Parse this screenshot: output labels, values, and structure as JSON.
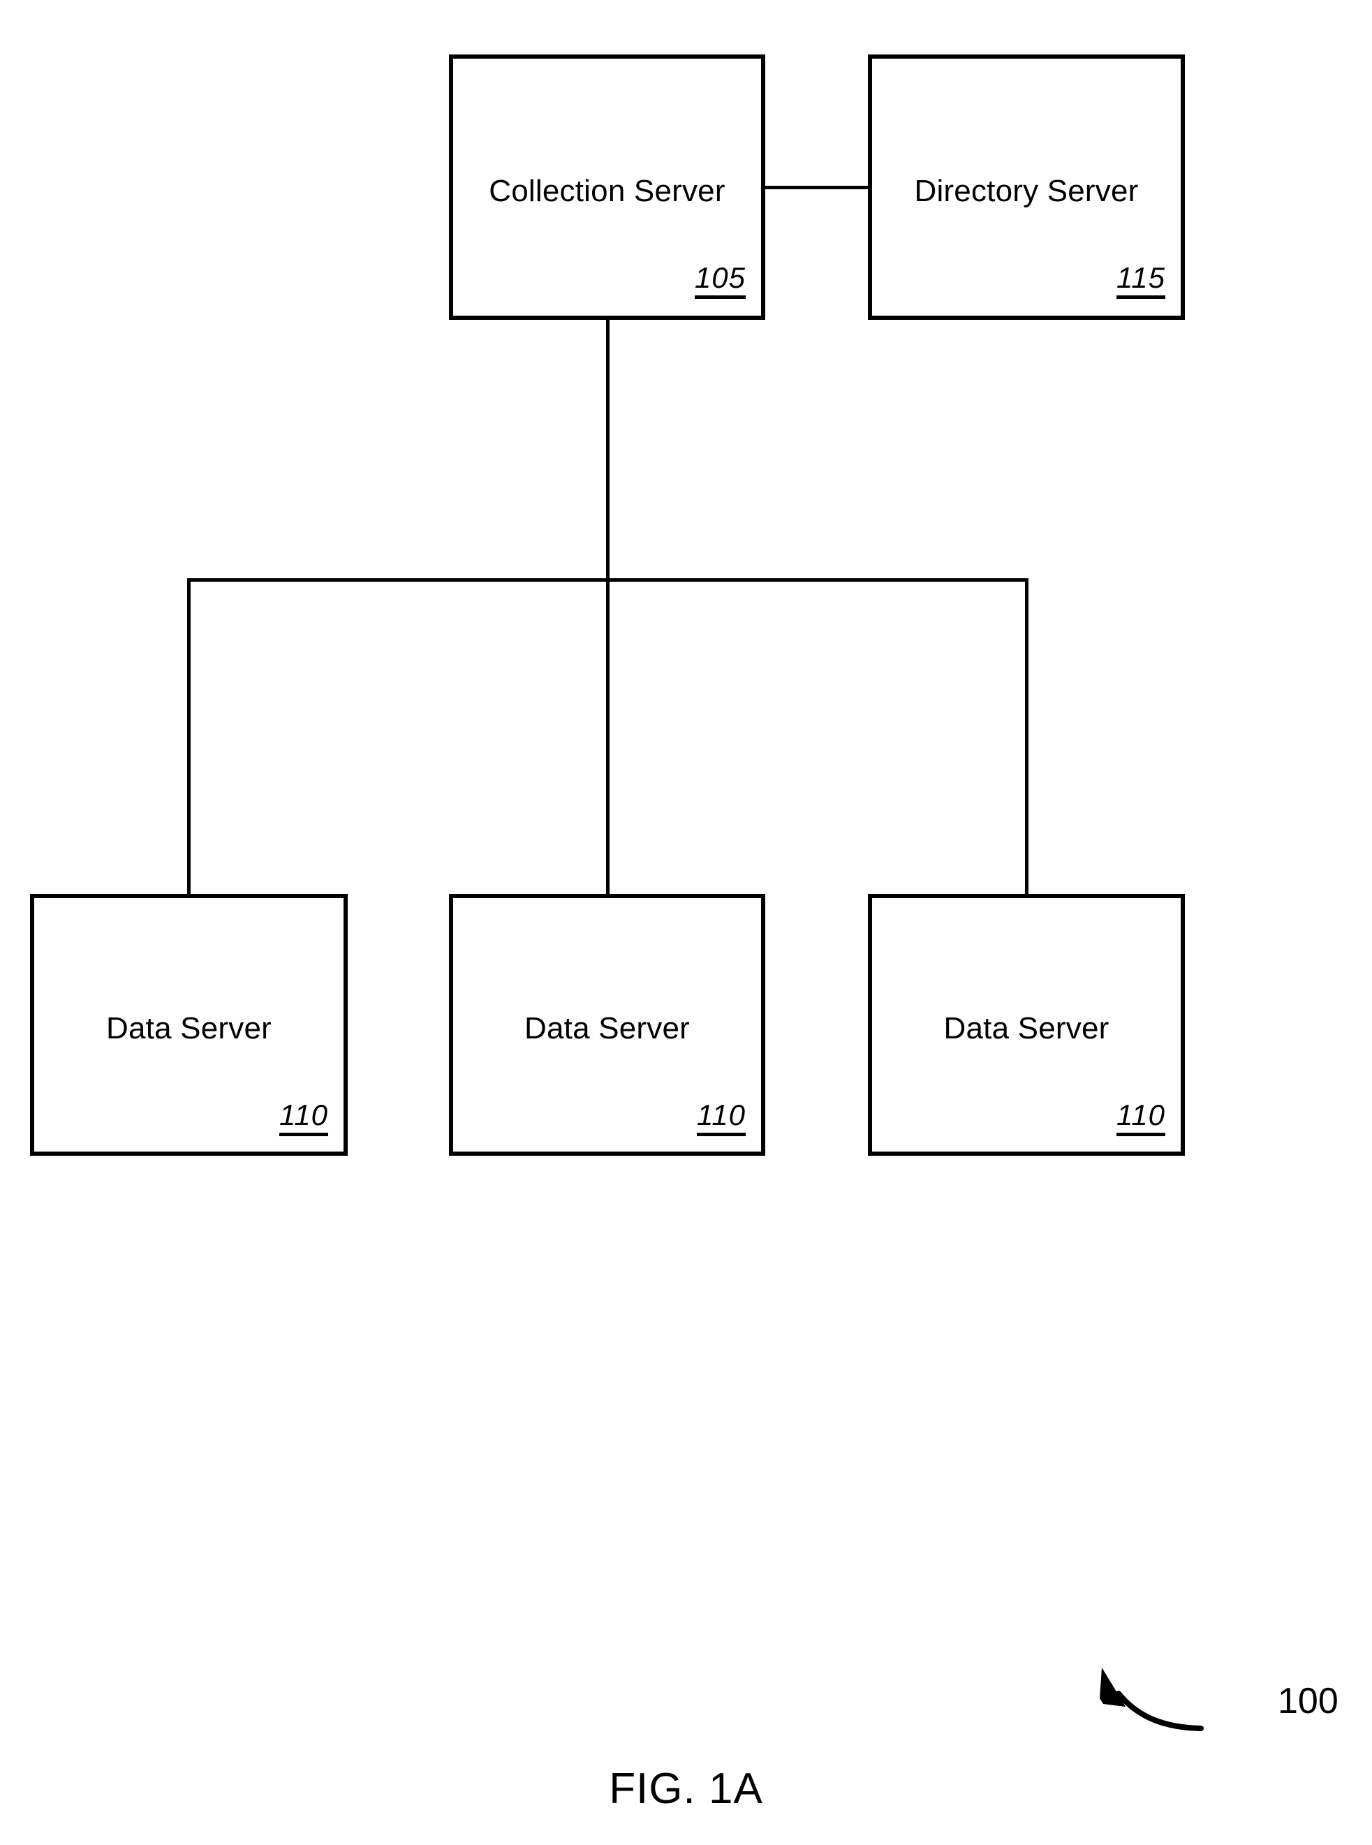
{
  "figure": {
    "caption": "FIG. 1A",
    "system_reference": "100"
  },
  "nodes": {
    "collection_server": {
      "label": "Collection Server",
      "reference": "105"
    },
    "directory_server": {
      "label": "Directory Server",
      "reference": "115"
    },
    "data_server_left": {
      "label": "Data Server",
      "reference": "110"
    },
    "data_server_center": {
      "label": "Data Server",
      "reference": "110"
    },
    "data_server_right": {
      "label": "Data Server",
      "reference": "110"
    }
  },
  "connectors": {
    "collection_to_directory": "horizontal-link",
    "collection_to_bus": "vertical-trunk",
    "bus": "horizontal-bus",
    "bus_to_data_left": "drop-line",
    "bus_to_data_center": "drop-line",
    "bus_to_data_right": "drop-line"
  },
  "style": {
    "stroke_color": "#000000",
    "background_color": "#ffffff"
  }
}
